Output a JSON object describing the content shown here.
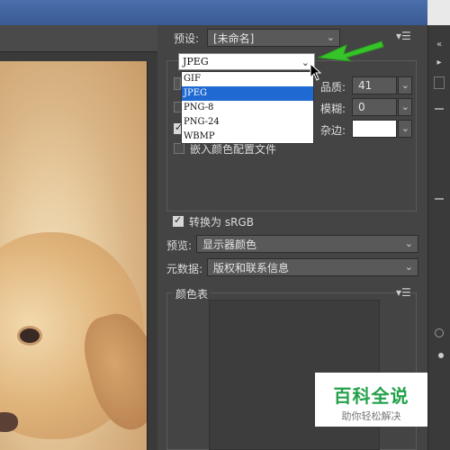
{
  "preset": {
    "label": "预设:",
    "value": "[未命名]"
  },
  "format": {
    "current": "JPEG",
    "options": [
      "GIF",
      "JPEG",
      "PNG-8",
      "PNG-24",
      "WBMP"
    ],
    "selected_index": 1
  },
  "settings": {
    "quality_label": "品质:",
    "quality_value": "41",
    "blur_label": "模糊:",
    "blur_value": "0",
    "matte_label": "杂边:",
    "embed_profile_label": "嵌入颜色配置文件"
  },
  "convert": {
    "label": "转换为 sRGB",
    "checked": true
  },
  "preview": {
    "label": "预览:",
    "value": "显示器颜色"
  },
  "metadata": {
    "label": "元数据:",
    "value": "版权和联系信息"
  },
  "color_table": {
    "label": "颜色表"
  },
  "watermark": {
    "main": "百科全说",
    "sub": "助你轻松解决"
  },
  "colors": {
    "accent": "#1e69d2",
    "arrow": "#37c42a",
    "watermark": "#23a14a"
  }
}
